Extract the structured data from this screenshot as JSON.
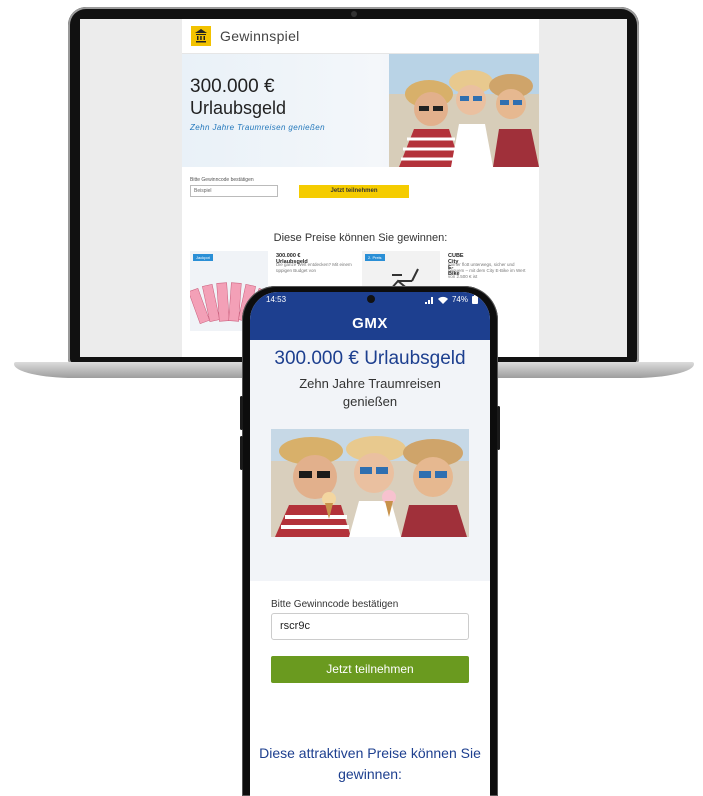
{
  "laptop": {
    "header": {
      "title": "Gewinnspiel"
    },
    "hero": {
      "amount": "300.000 €",
      "subtitle": "Urlaubsgeld",
      "tagline": "Zehn Jahre Traumreisen genießen"
    },
    "form": {
      "label": "Bitte Gewinncode bestätigen",
      "code_value": "Beispiel",
      "button": "Jetzt teilnehmen"
    },
    "prizes_title": "Diese Preise können Sie gewinnen:",
    "cards": [
      {
        "badge": "Jackpot",
        "title": "300.000 € Urlaubsgeld",
        "text": "Die ganze Welt entdecken? Mit einem üppigen Budget von"
      },
      {
        "badge": "2. Preis",
        "title": "CUBE City E-Bike",
        "text": "Immer flott unterwegs, sicher und bequem – mit dem City E-Bike im Wert von 2.500 € ist"
      }
    ]
  },
  "phone": {
    "status": {
      "time": "14:53",
      "battery": "74%"
    },
    "brand": "GMX",
    "hero": {
      "amount": "300.000 € Urlaubsgeld",
      "subtitle": "Zehn Jahre Traumreisen genießen"
    },
    "form": {
      "label": "Bitte Gewinncode bestätigen",
      "code_value": "rscr9c",
      "button": "Jetzt teilnehmen"
    },
    "prizes_title": "Diese attraktiven Preise können Sie gewinnen:"
  },
  "colors": {
    "gmx_blue": "#1d3f8f",
    "cta_green": "#6a9a1f",
    "cta_yellow": "#f5cc00",
    "logo_yellow": "#f2c200"
  },
  "icons": [
    "bank-logo-icon",
    "signal-icon",
    "wifi-icon",
    "battery-icon"
  ]
}
